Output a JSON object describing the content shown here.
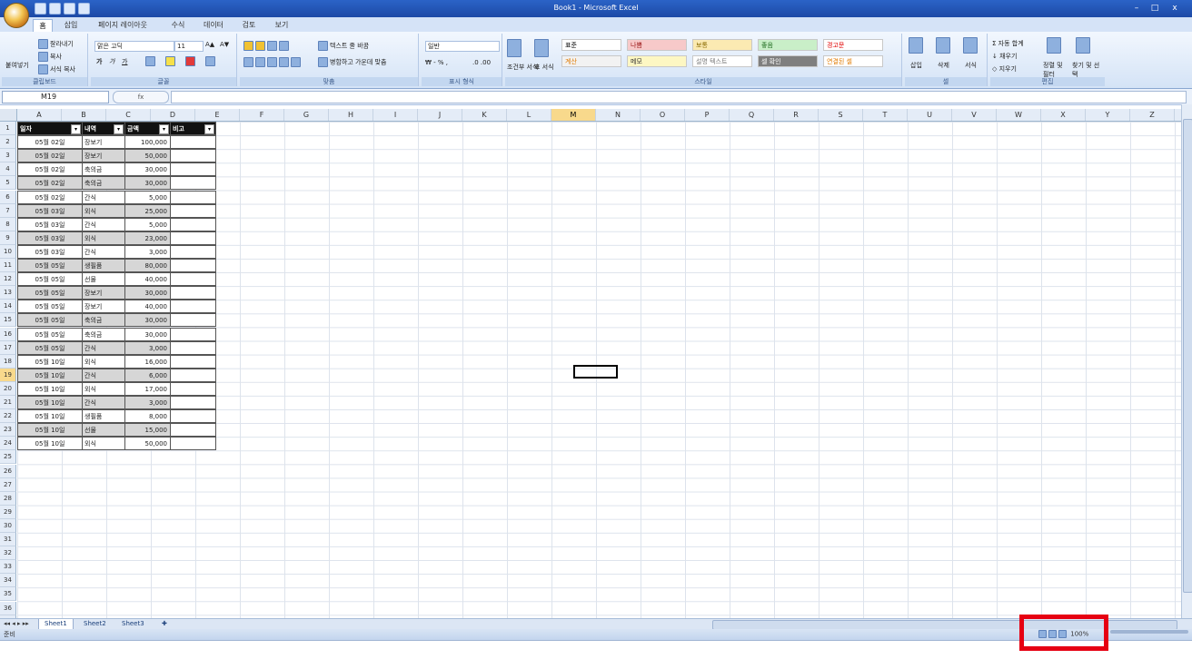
{
  "window": {
    "title": "Book1 - Microsoft Excel",
    "minimize": "–",
    "maximize": "□",
    "close": "x"
  },
  "ribbon_tabs": [
    "홈",
    "삽입",
    "페이지 레이아웃",
    "수식",
    "데이터",
    "검토",
    "보기"
  ],
  "ribbon": {
    "clipboard": {
      "paste": "붙여넣기",
      "cut": "잘라내기",
      "copy": "복사",
      "format_painter": "서식 복사",
      "label": "클립보드"
    },
    "font": {
      "font_name": "맑은 고딕",
      "font_size": "11",
      "label": "글꼴"
    },
    "alignment": {
      "wrap_text": "텍스트 줄 바꿈",
      "merge_center": "병합하고 가운데 맞춤",
      "label": "맞춤"
    },
    "number": {
      "format": "일반",
      "label": "표시 형식"
    },
    "styles": {
      "conditional": "조건부 서식",
      "table": "표 서식",
      "cells": [
        {
          "text": "표준",
          "bg": "#ffffff",
          "color": "#000000"
        },
        {
          "text": "나쁨",
          "bg": "#f7c9c9",
          "color": "#9c1a1a"
        },
        {
          "text": "보통",
          "bg": "#fbeab2",
          "color": "#8a6a00"
        },
        {
          "text": "좋음",
          "bg": "#c9efc8",
          "color": "#1f6b1f"
        },
        {
          "text": "경고문",
          "bg": "#ffffff",
          "color": "#e00000"
        },
        {
          "text": "계산",
          "bg": "#f2f2f2",
          "color": "#e07a00"
        },
        {
          "text": "메모",
          "bg": "#fdf7c3",
          "color": "#333333"
        },
        {
          "text": "설명 텍스트",
          "bg": "#ffffff",
          "color": "#777777"
        },
        {
          "text": "셀 확인",
          "bg": "#7f7f7f",
          "color": "#ffffff"
        },
        {
          "text": "연결된 셀",
          "bg": "#ffffff",
          "color": "#e07a00"
        }
      ],
      "label": "스타일"
    },
    "cells_group": {
      "insert": "삽입",
      "delete": "삭제",
      "format": "서식",
      "label": "셀"
    },
    "editing": {
      "autosum": "자동 합계",
      "fill": "채우기",
      "clear": "지우기",
      "sort": "정렬 및 필터",
      "find": "찾기 및 선택",
      "label": "편집"
    }
  },
  "formula_bar": {
    "name_box": "M19",
    "fx": "fx",
    "content": ""
  },
  "columns": [
    "A",
    "B",
    "C",
    "D",
    "E",
    "F",
    "G",
    "H",
    "I",
    "J",
    "K",
    "L",
    "M",
    "N",
    "O",
    "P",
    "Q",
    "R",
    "S",
    "T",
    "U",
    "V",
    "W",
    "X",
    "Y",
    "Z"
  ],
  "selected_column": "M",
  "selected_row": 19,
  "rows": [
    1,
    2,
    3,
    4,
    5,
    6,
    7,
    8,
    9,
    10,
    11,
    12,
    13,
    14,
    15,
    16,
    17,
    18,
    19,
    20,
    21,
    22,
    23,
    24,
    25,
    26,
    27,
    28,
    29,
    30,
    31,
    32,
    33,
    34,
    35,
    36,
    37
  ],
  "table": {
    "headers": [
      "일자",
      "내역",
      "금액",
      "비고"
    ],
    "rows": [
      [
        "05월 02일",
        "장보기",
        "100,000",
        ""
      ],
      [
        "05월 02일",
        "장보기",
        "50,000",
        ""
      ],
      [
        "05월 02일",
        "축의금",
        "30,000",
        ""
      ],
      [
        "05월 02일",
        "축의금",
        "30,000",
        ""
      ],
      [
        "05월 02일",
        "간식",
        "5,000",
        ""
      ],
      [
        "05월 03일",
        "외식",
        "25,000",
        ""
      ],
      [
        "05월 03일",
        "간식",
        "5,000",
        ""
      ],
      [
        "05월 03일",
        "외식",
        "23,000",
        ""
      ],
      [
        "05월 03일",
        "간식",
        "3,000",
        ""
      ],
      [
        "05월 05일",
        "생필품",
        "80,000",
        ""
      ],
      [
        "05월 05일",
        "선물",
        "40,000",
        ""
      ],
      [
        "05월 05일",
        "장보기",
        "30,000",
        ""
      ],
      [
        "05월 05일",
        "장보기",
        "40,000",
        ""
      ],
      [
        "05월 05일",
        "축의금",
        "30,000",
        ""
      ],
      [
        "05월 05일",
        "축의금",
        "30,000",
        ""
      ],
      [
        "05월 05일",
        "간식",
        "3,000",
        ""
      ],
      [
        "05월 10일",
        "외식",
        "16,000",
        ""
      ],
      [
        "05월 10일",
        "간식",
        "6,000",
        ""
      ],
      [
        "05월 10일",
        "외식",
        "17,000",
        ""
      ],
      [
        "05월 10일",
        "간식",
        "3,000",
        ""
      ],
      [
        "05월 10일",
        "생필품",
        "8,000",
        ""
      ],
      [
        "05월 10일",
        "선물",
        "15,000",
        ""
      ],
      [
        "05월 10일",
        "외식",
        "50,000",
        ""
      ]
    ]
  },
  "sheets": [
    "Sheet1",
    "Sheet2",
    "Sheet3"
  ],
  "active_sheet": "Sheet1",
  "status": {
    "ready": "준비",
    "zoom": "100%"
  },
  "highlight_color": "#e60012"
}
